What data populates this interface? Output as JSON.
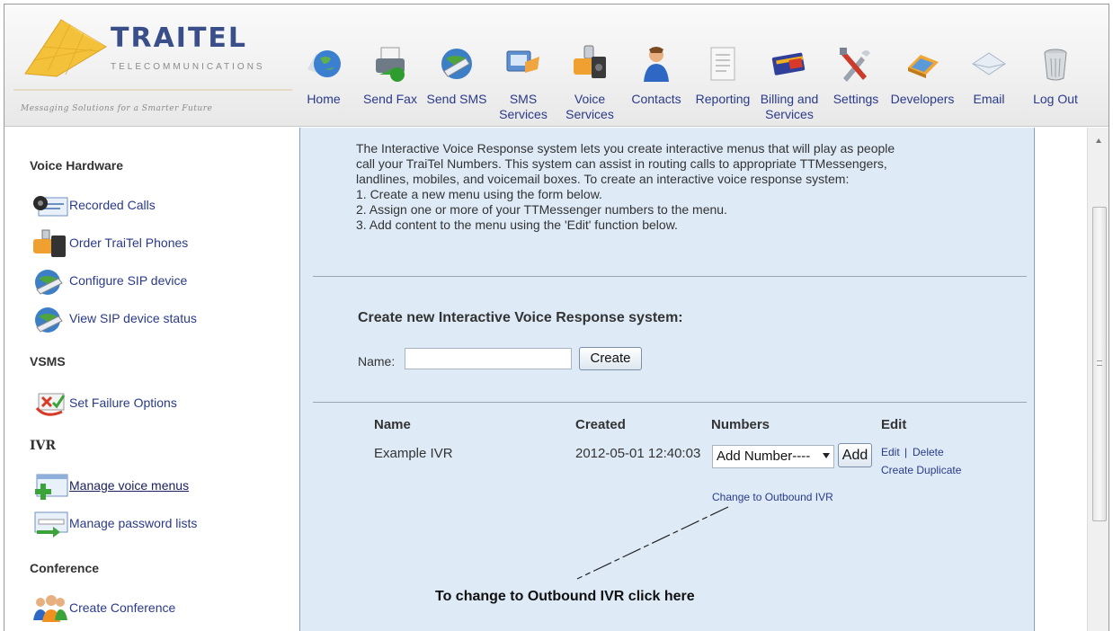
{
  "brand": {
    "name": "TRAITEL",
    "subtitle": "TELECOMMUNICATIONS",
    "tagline": "Messaging Solutions for a Smarter Future"
  },
  "nav": [
    {
      "icon": "globe-icon",
      "label": "Home"
    },
    {
      "icon": "fax-icon",
      "label": "Send Fax"
    },
    {
      "icon": "sms-globe-icon",
      "label": "Send SMS"
    },
    {
      "icon": "sms-services-icon",
      "label": "SMS Services"
    },
    {
      "icon": "voice-phone-icon",
      "label": "Voice Services"
    },
    {
      "icon": "contacts-person-icon",
      "label": "Contacts"
    },
    {
      "icon": "report-document-icon",
      "label": "Reporting"
    },
    {
      "icon": "credit-card-icon",
      "label": "Billing and Services"
    },
    {
      "icon": "tools-icon",
      "label": "Settings"
    },
    {
      "icon": "laptop-icon",
      "label": "Developers"
    },
    {
      "icon": "envelope-icon",
      "label": "Email"
    },
    {
      "icon": "trash-can-icon",
      "label": "Log Out"
    }
  ],
  "sidebar": {
    "sections": [
      {
        "title": "Voice Hardware",
        "items": [
          {
            "icon": "recorded-calls-icon",
            "label": "Recorded Calls"
          },
          {
            "icon": "phone-order-icon",
            "label": "Order TraiTel Phones"
          },
          {
            "icon": "sip-globe-icon",
            "label": "Configure SIP device"
          },
          {
            "icon": "sip-status-globe-icon",
            "label": "View SIP device status"
          }
        ]
      },
      {
        "title": "VSMS",
        "items": [
          {
            "icon": "failure-options-icon",
            "label": "Set Failure Options"
          }
        ]
      },
      {
        "title": "IVR",
        "items": [
          {
            "icon": "voice-menu-icon",
            "label": "Manage voice menus"
          },
          {
            "icon": "password-list-icon",
            "label": "Manage password lists"
          }
        ]
      },
      {
        "title": "Conference",
        "items": [
          {
            "icon": "conference-people-icon",
            "label": "Create Conference"
          }
        ]
      }
    ]
  },
  "main": {
    "intro_lines": [
      "The Interactive Voice Response system lets you create interactive menus that will play as people",
      "call your TraiTel Numbers. This system can assist in routing calls to appropriate TTMessengers,",
      "landlines, mobiles, and voicemail boxes. To create an interactive voice response system:",
      "1. Create a new menu using the form below.",
      "2. Assign one or more of your TTMessenger numbers to the menu.",
      "3. Add content to the menu using the 'Edit' function below."
    ],
    "create_title": "Create new Interactive Voice Response system:",
    "name_label": "Name:",
    "name_value": "",
    "create_button": "Create",
    "table": {
      "headers": [
        "Name",
        "Created",
        "Numbers",
        "Edit"
      ],
      "row": {
        "name": "Example IVR",
        "created": "2012-05-01 12:40:03",
        "numbers_select": "Add Number----",
        "add_button": "Add",
        "edit_link": "Edit",
        "separator": "|",
        "delete_link": "Delete",
        "duplicate_link": "Create Duplicate",
        "outbound_link": "Change to Outbound IVR"
      }
    },
    "annotation": "To change to Outbound IVR click here"
  }
}
